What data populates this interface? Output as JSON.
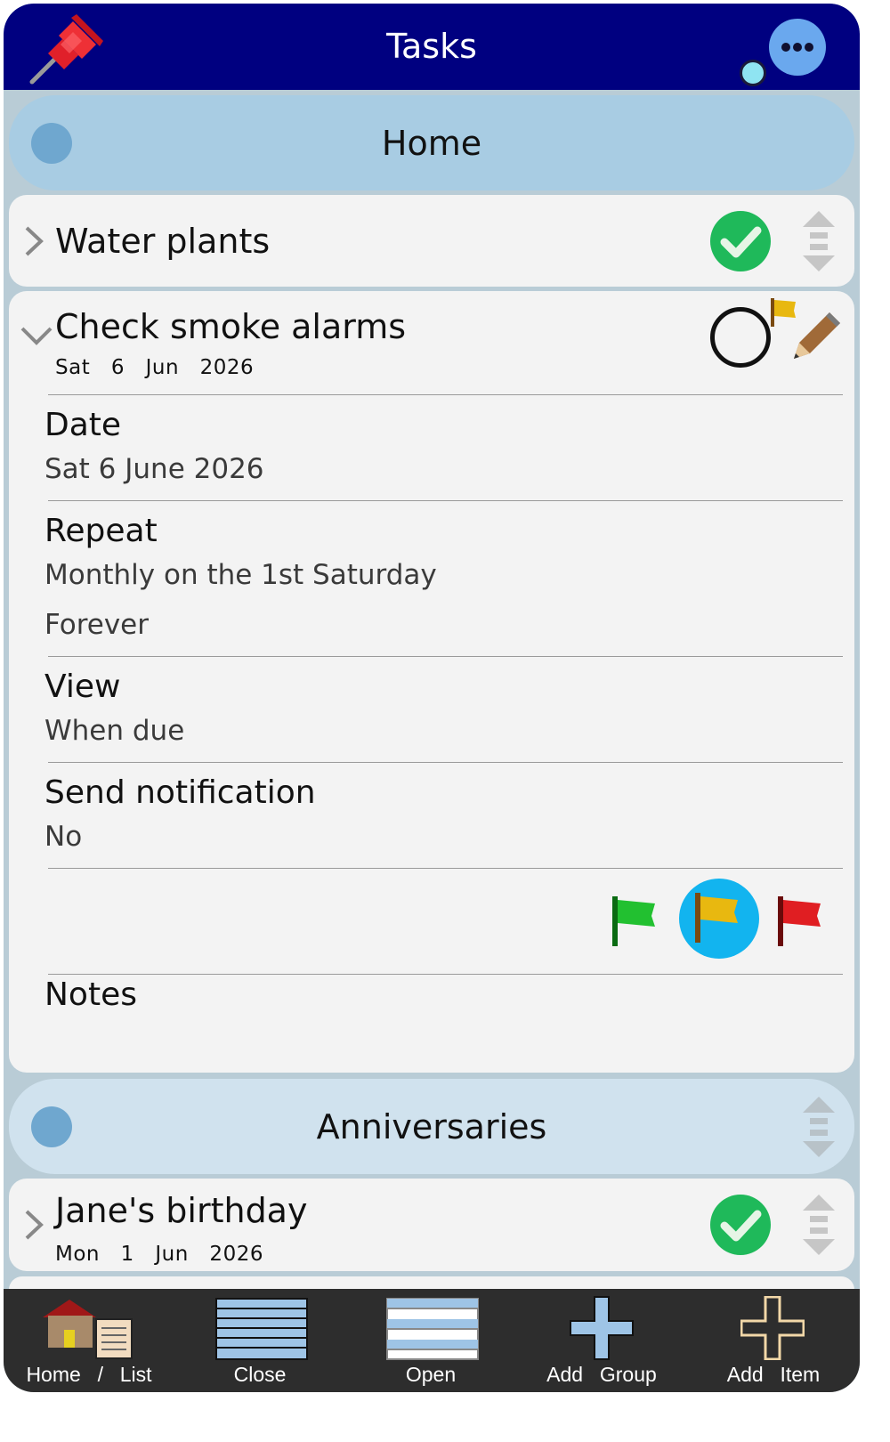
{
  "header": {
    "title": "Tasks",
    "pin_icon": "pushpin-icon",
    "more_icon": "ellipsis-icon",
    "sync_icon": "status-dot-icon"
  },
  "groups": [
    {
      "title": "Home",
      "items": [
        {
          "title": "Water plants",
          "status": "done"
        },
        {
          "title": "Check smoke alarms",
          "date": "Sat  6  Jun  2026",
          "status": "open",
          "expanded": true,
          "details": {
            "date_label": "Date",
            "date_value": "Sat 6 June 2026",
            "repeat_label": "Repeat",
            "repeat_value": "Monthly on the 1st Saturday",
            "repeat_end": "Forever",
            "view_label": "View",
            "view_value": "When due",
            "notify_label": "Send notification",
            "notify_value": "No",
            "notes_label": "Notes",
            "priority_options": [
              "green-flag",
              "yellow-flag",
              "red-flag"
            ],
            "priority_selected": "yellow-flag"
          }
        }
      ]
    },
    {
      "title": "Anniversaries",
      "items": [
        {
          "title": "Jane's birthday",
          "date": "Mon  1  Jun  2026",
          "status": "done"
        }
      ]
    }
  ],
  "toolbar": {
    "home_list": "Home  /  List",
    "close": "Close",
    "open": "Open",
    "add_group": "Add  Group",
    "add_item": "Add  Item"
  },
  "colors": {
    "header": "#000080",
    "background": "#b9ccd6",
    "group_active": "#a8cce3",
    "group_inactive": "#d0e2ee",
    "done_green": "#1fb95a",
    "selected_flag_bg": "#12b4ef",
    "toolbar": "#2d2d2d"
  }
}
